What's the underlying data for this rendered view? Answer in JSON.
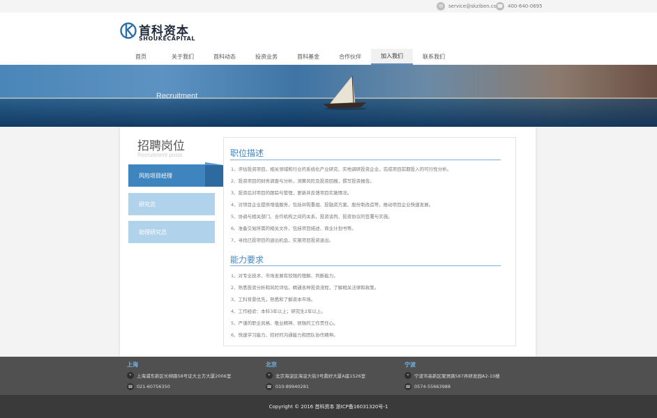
{
  "topbar": {
    "email": "service@skziben.com",
    "phone": "400-640-0695",
    "email_icon": "mail-icon",
    "phone_icon": "phone-icon"
  },
  "logo": {
    "cn": "首科资本",
    "en": "SHOUKECAPITAL"
  },
  "nav": {
    "items": [
      "首页",
      "关于我们",
      "首科动态",
      "投资业务",
      "首科基金",
      "合作伙伴",
      "加入我们",
      "联系我们"
    ],
    "active_index": 6
  },
  "banner": {
    "title": "Recruitment"
  },
  "sidebar": {
    "title": "招聘岗位",
    "subtitle": "Recruitment posts",
    "items": [
      "风险项目经理",
      "研究员",
      "助理研究员"
    ],
    "active_index": 0
  },
  "content": {
    "section1_title": "职位描述",
    "section1_lines": [
      "1、评估投资项目，相关领域和行业的系统化产业研究、实地调研投资企业，完成项目前期投入的可行性分析。",
      "2、投资项目的财务调查与分析，测算风险及投资回报，撰写投资报告。",
      "3、投资后对项目的跟踪与管理，更新并反馈项目实施情况。",
      "4、对项目企业提供增值服务，包括并购重组、投融资方案、股份制改造等，推动项目企业快速发展。",
      "5、协调与相关部门、合作机构之间的关系，投资谈判、投资协议的签署与实施。",
      "6、准备交易所需的相关文件，包括项目描述、商业计划书等。",
      "7、寻找已投项目的退出机会，实施项目投资退出。"
    ],
    "section2_title": "能力要求",
    "section2_lines": [
      "1、对专业技术、市场发展有较强的理解、判断能力。",
      "2、熟悉投资分析和风险评估，精通各种投资流程，了解相关法律和政策。",
      "3、工科背景优先，熟悉和了解资本市场。",
      "4、工作经验：本科3年以上；研究生2年以上。",
      "5、严谨的职业风格、敬业精神、很强的工作责任心。",
      "6、快速学习能力、较好的沟通能力和团队协作精神。"
    ]
  },
  "footer": {
    "offices": [
      {
        "city": "上海",
        "address": "上海浦东新区长柳路58号证大立方大厦2006室",
        "phone": "021-60756350"
      },
      {
        "city": "北京",
        "address": "北京海淀区海淀大街3号鼎好大厦A座1526室",
        "phone": "010-89940281"
      },
      {
        "city": "宁波",
        "address": "宁波市高新区聚贤路587弄研发园A2-10楼",
        "phone": "0574-55663988"
      }
    ],
    "copyright": "Copyright © 2016 首科资本 浙ICP备16031320号-1"
  }
}
